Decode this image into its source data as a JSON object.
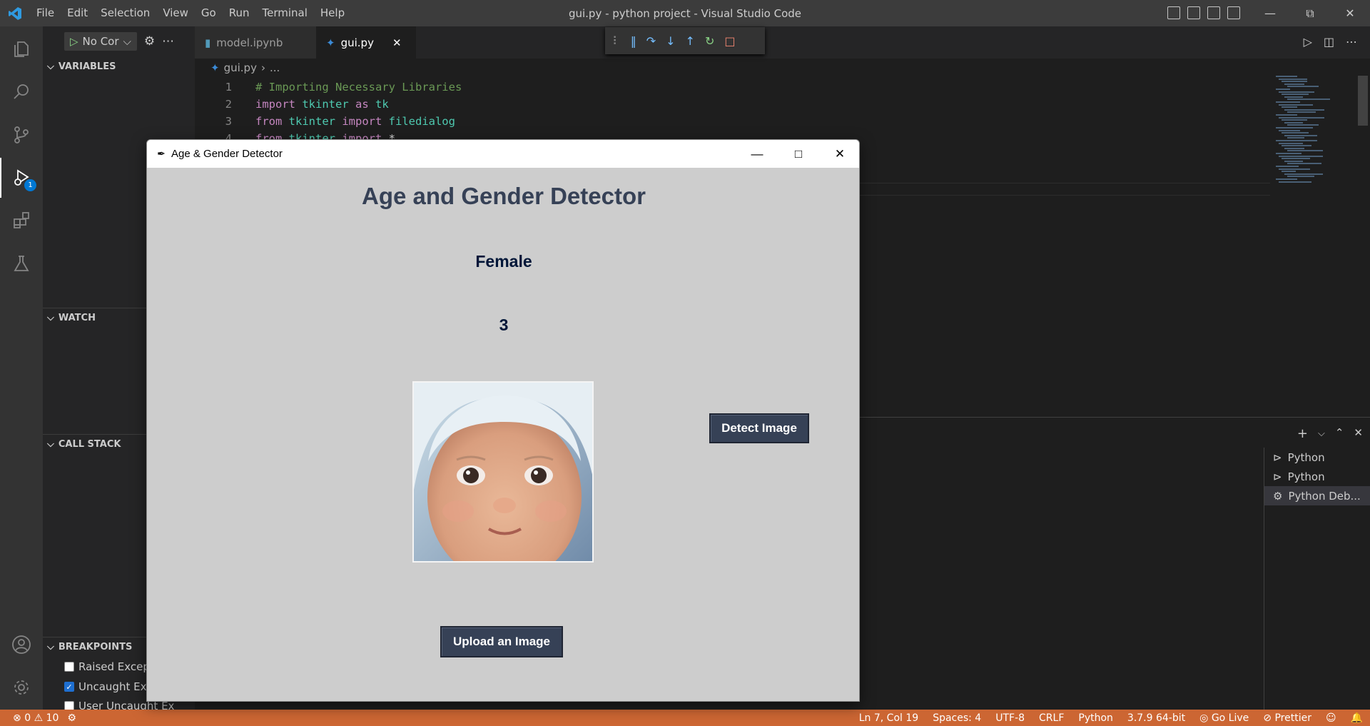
{
  "window": {
    "title": "gui.py - python project - Visual Studio Code",
    "menu": [
      "File",
      "Edit",
      "Selection",
      "View",
      "Go",
      "Run",
      "Terminal",
      "Help"
    ]
  },
  "activity": {
    "items": [
      "explorer-icon",
      "search-icon",
      "source-control-icon",
      "run-debug-icon",
      "extensions-icon",
      "testing-icon"
    ],
    "debug_badge": "1"
  },
  "debug_sidebar": {
    "run_config": "No Cor",
    "sections": {
      "variables": "VARIABLES",
      "watch": "WATCH",
      "call_stack": "CALL STACK",
      "breakpoints": "BREAKPOINTS"
    },
    "breakpoints": [
      {
        "label": "Raised Excep",
        "checked": false
      },
      {
        "label": "Uncaught Exc",
        "checked": true
      },
      {
        "label": "User Uncaught Ex",
        "checked": false
      }
    ]
  },
  "editor": {
    "tabs": [
      {
        "label": "model.ipynb",
        "active": false
      },
      {
        "label": "gui.py",
        "active": true
      }
    ],
    "breadcrumb": {
      "file": "gui.py",
      "rest": "..."
    },
    "code": [
      {
        "num": "1",
        "parts": [
          {
            "t": "# Importing Necessary Libraries",
            "c": "cm"
          }
        ]
      },
      {
        "num": "2",
        "parts": [
          {
            "t": "import ",
            "c": "kw"
          },
          {
            "t": "tkinter ",
            "c": "id"
          },
          {
            "t": "as ",
            "c": "kw"
          },
          {
            "t": "tk",
            "c": "id"
          }
        ]
      },
      {
        "num": "3",
        "parts": [
          {
            "t": "from ",
            "c": "kw"
          },
          {
            "t": "tkinter ",
            "c": "id"
          },
          {
            "t": "import ",
            "c": "kw"
          },
          {
            "t": "filedialog",
            "c": "id"
          }
        ]
      },
      {
        "num": "4",
        "parts": [
          {
            "t": "from ",
            "c": "kw"
          },
          {
            "t": "tkinter ",
            "c": "id"
          },
          {
            "t": "import ",
            "c": "kw"
          },
          {
            "t": "*",
            "c": "tx"
          }
        ]
      }
    ]
  },
  "panel": {
    "terminals": [
      "Python",
      "Python",
      "Python Deb..."
    ],
    "selected_terminal": 2
  },
  "statusbar": {
    "errors": "0",
    "warnings": "10",
    "position": "Ln 7, Col 19",
    "spaces": "Spaces: 4",
    "encoding": "UTF-8",
    "eol": "CRLF",
    "language": "Python",
    "interpreter": "3.7.9 64-bit",
    "golive": "Go Live",
    "prettier": "Prettier"
  },
  "app": {
    "window_title": "Age & Gender Detector",
    "heading": "Age and Gender Detector",
    "gender_result": "Female",
    "age_result": "3",
    "detect_button": "Detect Image",
    "upload_button": "Upload an Image",
    "colors": {
      "background": "#cdcdcd",
      "accent": "#364156"
    }
  },
  "colors": {
    "statusbar": "#cc6633",
    "activitybar": "#333333",
    "sidebar": "#252526",
    "editor": "#1e1e1e"
  }
}
